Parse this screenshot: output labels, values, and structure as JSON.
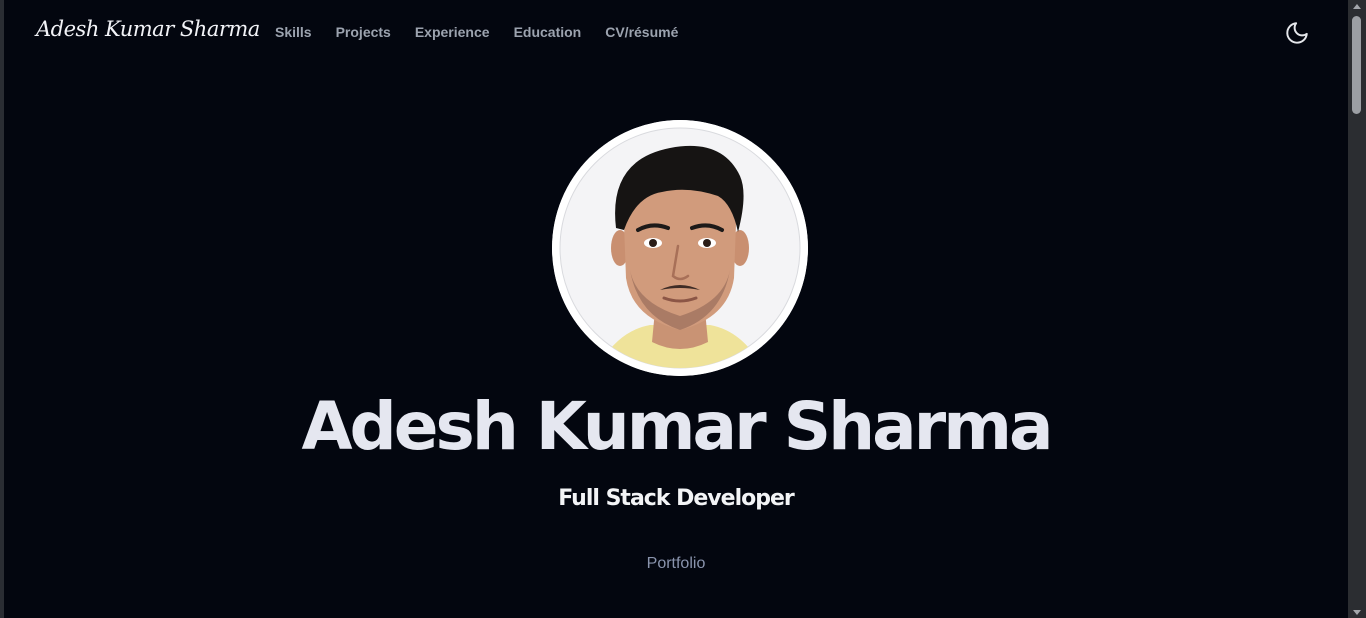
{
  "header": {
    "logo": "Adesh Kumar Sharma",
    "nav": [
      {
        "label": "Skills"
      },
      {
        "label": "Projects"
      },
      {
        "label": "Experience"
      },
      {
        "label": "Education"
      },
      {
        "label": "CV/résumé"
      }
    ],
    "theme_toggle_icon": "moon-icon"
  },
  "hero": {
    "avatar_icon": "profile-photo",
    "name": "Adesh Kumar Sharma",
    "role": "Full Stack Developer",
    "tagline": "Portfolio"
  },
  "colors": {
    "background": "#03060f",
    "heading": "#e5e7f0",
    "nav_text": "#9ca3af",
    "muted": "#8a94ad"
  }
}
